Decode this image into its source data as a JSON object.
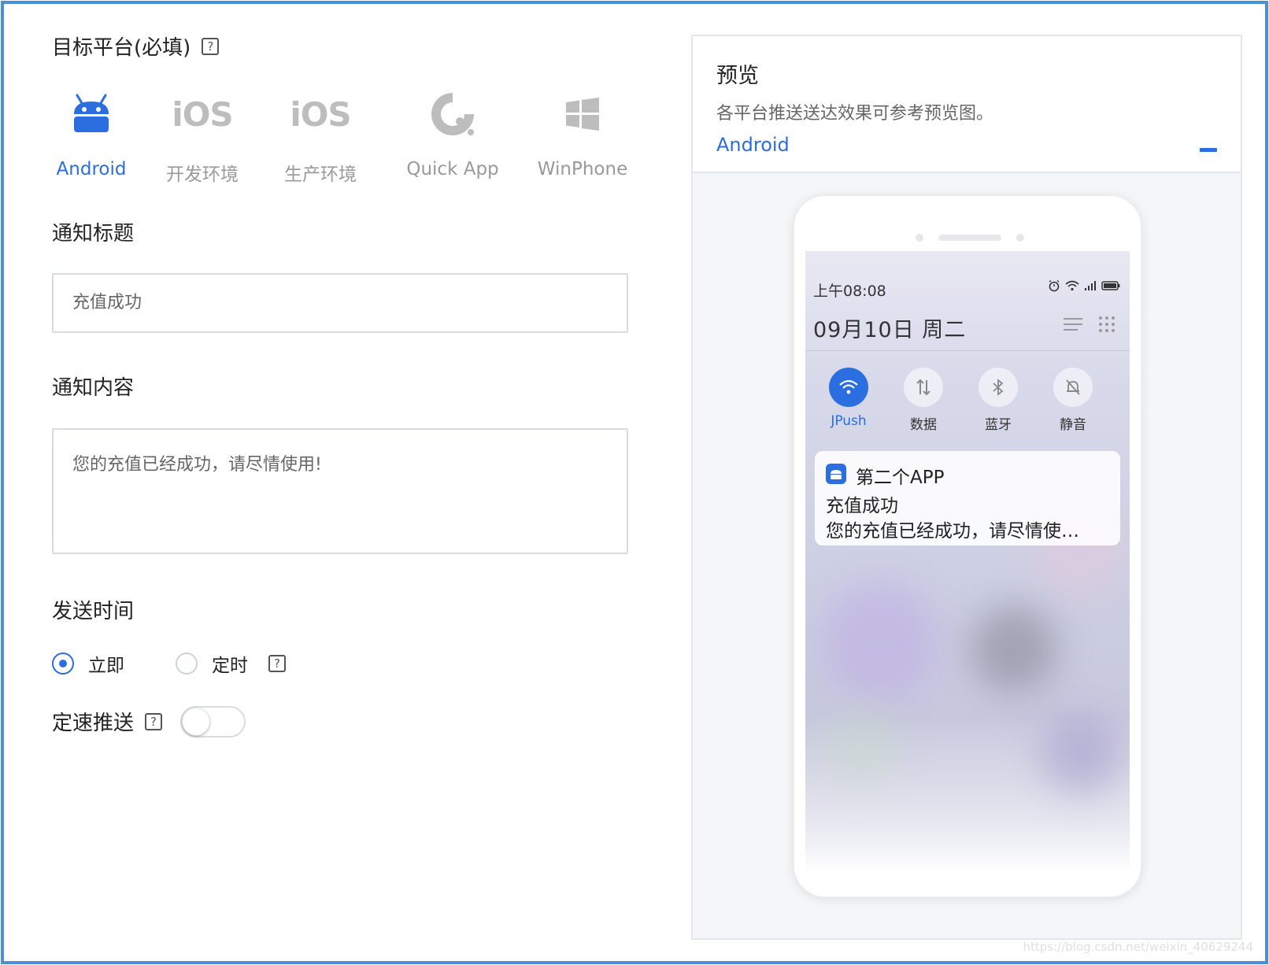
{
  "form": {
    "platform_title": "目标平台(必填)",
    "help_glyph": "?",
    "platforms": [
      {
        "label": "Android",
        "icon": "android-icon",
        "active": true
      },
      {
        "label": "开发环境",
        "icon": "ios-dev-icon",
        "icon_text": "iOS",
        "active": false
      },
      {
        "label": "生产环境",
        "icon": "ios-prod-icon",
        "icon_text": "iOS",
        "active": false
      },
      {
        "label": "Quick App",
        "icon": "quickapp-icon",
        "active": false
      },
      {
        "label": "WinPhone",
        "icon": "windows-icon",
        "active": false
      }
    ],
    "title_label": "通知标题",
    "title_value": "充值成功",
    "content_label": "通知内容",
    "content_value": "您的充值已经成功，请尽情使用!",
    "send_time_label": "发送时间",
    "send_options": [
      {
        "label": "立即",
        "checked": true
      },
      {
        "label": "定时",
        "checked": false
      }
    ],
    "rate_push_label": "定速推送",
    "rate_push_enabled": false
  },
  "preview": {
    "title": "预览",
    "description": "各平台推送送达效果可参考预览图。",
    "active_tab": "Android",
    "phone": {
      "status_time": "上午08:08",
      "date": "09月10日  周二",
      "quick_settings": [
        {
          "label": "JPush",
          "icon": "wifi-icon",
          "on": true
        },
        {
          "label": "数据",
          "icon": "data-icon",
          "on": false
        },
        {
          "label": "蓝牙",
          "icon": "bluetooth-icon",
          "on": false
        },
        {
          "label": "静音",
          "icon": "mute-icon",
          "on": false
        }
      ],
      "notification": {
        "app_name": "第二个APP",
        "title": "充值成功",
        "body": "您的充值已经成功，请尽情使…"
      }
    }
  },
  "watermark": "https://blog.csdn.net/weixin_40629244",
  "colors": {
    "accent": "#2a6ee0",
    "frame": "#4a8fd9",
    "muted": "#9a9a9a",
    "border": "#d8dbe0"
  }
}
